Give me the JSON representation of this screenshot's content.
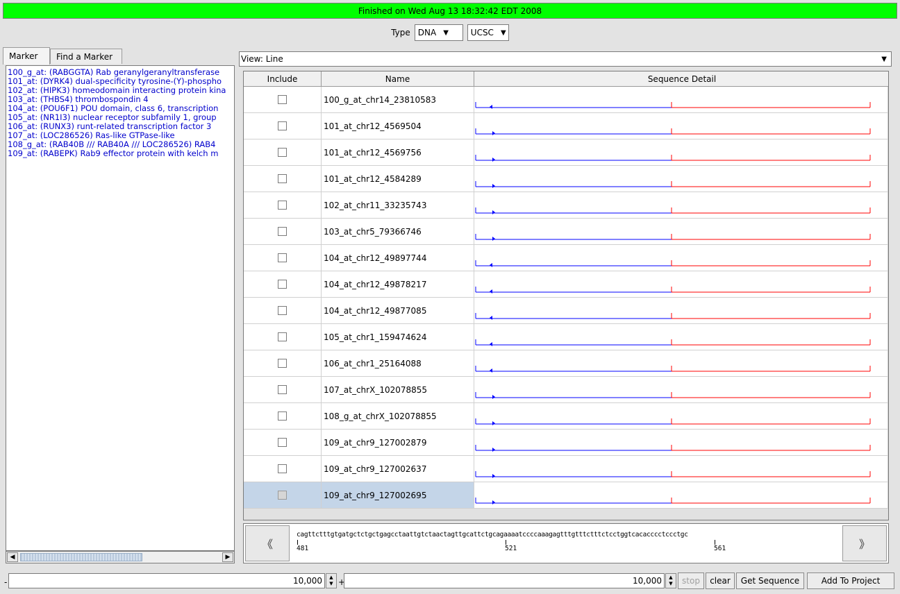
{
  "status": {
    "text": "Finished on Wed Aug 13 18:32:42 EDT 2008",
    "color": "#00ff00"
  },
  "type_selector": {
    "label": "Type",
    "type_value": "DNA",
    "source_value": "UCSC"
  },
  "left_tabs": [
    {
      "label": "Marker"
    },
    {
      "label": "Find a Marker"
    }
  ],
  "markers": [
    "100_g_at: (RABGGTA) Rab geranylgeranyltransferase",
    "101_at: (DYRK4) dual-specificity tyrosine-(Y)-phospho",
    "102_at: (HIPK3) homeodomain interacting protein kina",
    "103_at: (THBS4) thrombospondin 4",
    "104_at: (POU6F1) POU domain, class 6, transcription",
    "105_at: (NR1I3) nuclear receptor subfamily 1, group",
    "106_at: (RUNX3) runt-related transcription factor 3",
    "107_at: (LOC286526) Ras-like GTPase-like",
    "108_g_at: (RAB40B /// RAB40A /// LOC286526) RAB4",
    "109_at: (RABEPK) Rab9 effector protein with kelch m"
  ],
  "view": {
    "label": "View:",
    "value": "Line"
  },
  "table": {
    "headers": {
      "include": "Include",
      "name": "Name",
      "detail": "Sequence Detail"
    },
    "rows": [
      {
        "name": "100_g_at_chr14_23810583",
        "strand": "minus"
      },
      {
        "name": "101_at_chr12_4569504",
        "strand": "plus"
      },
      {
        "name": "101_at_chr12_4569756",
        "strand": "plus"
      },
      {
        "name": "101_at_chr12_4584289",
        "strand": "plus"
      },
      {
        "name": "102_at_chr11_33235743",
        "strand": "plus"
      },
      {
        "name": "103_at_chr5_79366746",
        "strand": "plus"
      },
      {
        "name": "104_at_chr12_49897744",
        "strand": "minus"
      },
      {
        "name": "104_at_chr12_49878217",
        "strand": "minus"
      },
      {
        "name": "104_at_chr12_49877085",
        "strand": "minus"
      },
      {
        "name": "105_at_chr1_159474624",
        "strand": "minus"
      },
      {
        "name": "106_at_chr1_25164088",
        "strand": "minus"
      },
      {
        "name": "107_at_chrX_102078855",
        "strand": "plus"
      },
      {
        "name": "108_g_at_chrX_102078855",
        "strand": "plus"
      },
      {
        "name": "109_at_chr9_127002879",
        "strand": "plus"
      },
      {
        "name": "109_at_chr9_127002637",
        "strand": "plus"
      },
      {
        "name": "109_at_chr9_127002695",
        "strand": "plus",
        "selected": true
      }
    ]
  },
  "sequence_view": {
    "prev_icon": "double-chevron-left-icon",
    "next_icon": "double-chevron-right-icon",
    "sequence": "cagttctttgtgatgctctgctgagcctaattgtctaactagttgcattctgcagaaaatccccaaagagtttgtttctttctcctggtcacacccctccctgc",
    "positions": [
      "481",
      "521",
      "561"
    ]
  },
  "bottom": {
    "left_prefix": "-",
    "left_value": "10,000",
    "plus_label": "+",
    "right_value": "10,000",
    "stop_label": "stop",
    "clear_label": "clear",
    "get_sequence_label": "Get Sequence",
    "add_to_project_label": "Add To Project"
  },
  "colors": {
    "upstream": "#0000ff",
    "downstream": "#ff0000",
    "marker_text": "#0000cc"
  }
}
